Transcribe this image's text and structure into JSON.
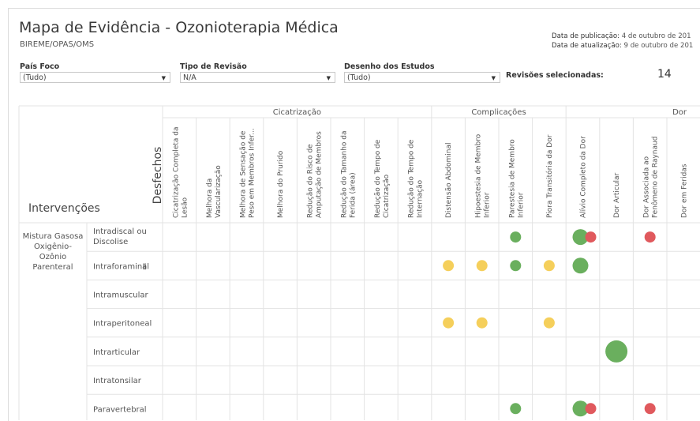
{
  "header": {
    "title": "Mapa de Evidência - Ozonioterapia Médica",
    "subtitle": "BIREME/OPAS/OMS",
    "pub_label": "Data de publicação:",
    "pub_value": "4 de outubro de 201",
    "upd_label": "Data de atualização:",
    "upd_value": "9 de outubro de 201"
  },
  "filters": {
    "pais": {
      "label": "País Foco",
      "value": "(Tudo)"
    },
    "tipo": {
      "label": "Tipo de Revisão",
      "value": "N/A"
    },
    "desenho": {
      "label": "Desenho dos Estudos",
      "value": "(Tudo)"
    },
    "revisoes_label": "Revisões selecionadas:",
    "revisoes_count": "14"
  },
  "matrix": {
    "axis_label_cols": "Desfechos",
    "axis_label_rows": "Intervenções",
    "groups": [
      "Cicatrização",
      "Complicações",
      "Dor"
    ],
    "columns": [
      "Cicatrização Completa da Lesão",
      "Melhora da Vascularização",
      "Melhora de Sensação de Peso em Membros Inferi...",
      "Melhora do Prurido",
      "Redução do Risco de Amputação de Membros",
      "Redução do Tamanho da Ferida (área)",
      "Redução do Tempo de Cicatrização",
      "Redução do Tempo de Internação",
      "Distensão Abdominal",
      "Hipoestesia de Membro Inferior",
      "Parestesia de Membro Inferior",
      "Piora Transitória da Dor",
      "Alívio Completo da Dor",
      "Dor Articular",
      "Dor Associada ao Fenômeno de Raynaud",
      "Dor em Feridas"
    ],
    "intervention_group": "Mistura Gasosa Oxigênio-Ozônio Parenteral",
    "rows": [
      "Intradiscal ou Discolise",
      "Intraforaminal",
      "Intramuscular",
      "Intraperitoneal",
      "Intrarticular",
      "Intratonsilar",
      "Paravertebral"
    ],
    "bubbles": [
      {
        "row": 0,
        "col": 10,
        "color": "green",
        "size": "small"
      },
      {
        "row": 0,
        "col": 12,
        "color": "green",
        "size": "medium"
      },
      {
        "row": 0,
        "col": 12,
        "color": "red",
        "size": "small",
        "offset": true
      },
      {
        "row": 0,
        "col": 14,
        "color": "red",
        "size": "small"
      },
      {
        "row": 1,
        "col": 8,
        "color": "yellow",
        "size": "small"
      },
      {
        "row": 1,
        "col": 9,
        "color": "yellow",
        "size": "small"
      },
      {
        "row": 1,
        "col": 10,
        "color": "green",
        "size": "small"
      },
      {
        "row": 1,
        "col": 11,
        "color": "yellow",
        "size": "small"
      },
      {
        "row": 1,
        "col": 12,
        "color": "green",
        "size": "medium"
      },
      {
        "row": 3,
        "col": 8,
        "color": "yellow",
        "size": "small"
      },
      {
        "row": 3,
        "col": 9,
        "color": "yellow",
        "size": "small"
      },
      {
        "row": 3,
        "col": 11,
        "color": "yellow",
        "size": "small"
      },
      {
        "row": 4,
        "col": 13,
        "color": "green",
        "size": "large"
      },
      {
        "row": 6,
        "col": 10,
        "color": "green",
        "size": "small"
      },
      {
        "row": 6,
        "col": 12,
        "color": "green",
        "size": "medium"
      },
      {
        "row": 6,
        "col": 12,
        "color": "red",
        "size": "small",
        "offset": true
      },
      {
        "row": 6,
        "col": 14,
        "color": "red",
        "size": "small"
      }
    ],
    "colors": {
      "green": "#6aaf5e",
      "red": "#e0595d",
      "yellow": "#f5cf5b"
    }
  }
}
